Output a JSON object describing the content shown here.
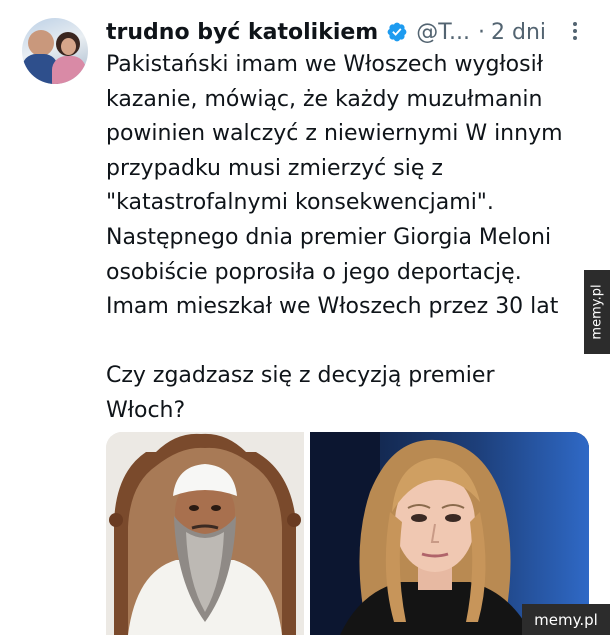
{
  "author": {
    "name": "trudno być katolikiem",
    "handle": "@T...",
    "separator": "·",
    "time": "2 dni"
  },
  "tweet": {
    "lines": [
      "Pakistański imam we Włoszech wygłosił",
      "kazanie, mówiąc, że każdy muzułmanin",
      "powinien walczyć z niewiernymi W innym",
      "przypadku musi zmierzyć się z",
      "\"katastrofalnymi konsekwencjami\".",
      "Następnego dnia premier Giorgia Meloni",
      "osobiście poprosiła o jego deportację.",
      "Imam mieszkał we Włoszech przez 30 lat"
    ],
    "question_lines": [
      "Czy zgadzasz się z decyzją premier",
      "Włoch?"
    ]
  },
  "watermark": {
    "side": "memy.pl",
    "corner": "memy.pl"
  },
  "icons": {
    "verified": "verified-badge-icon",
    "more": "more-options-icon"
  },
  "colors": {
    "text": "#0f1419",
    "muted": "#536471",
    "verified": "#1d9bf0"
  }
}
